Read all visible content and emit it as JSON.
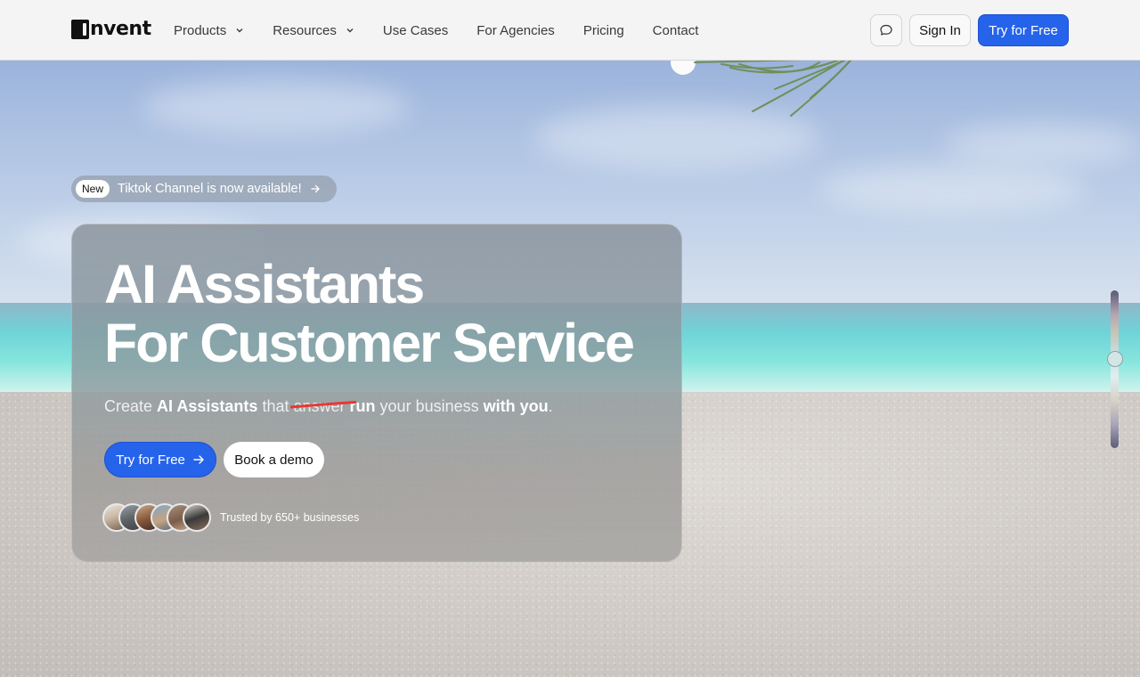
{
  "nav": {
    "logo_text": "nvent",
    "items": [
      {
        "label": "Products",
        "has_dropdown": true
      },
      {
        "label": "Resources",
        "has_dropdown": true
      },
      {
        "label": "Use Cases",
        "has_dropdown": false
      },
      {
        "label": "For Agencies",
        "has_dropdown": false
      },
      {
        "label": "Pricing",
        "has_dropdown": false
      },
      {
        "label": "Contact",
        "has_dropdown": false
      }
    ],
    "chat_icon": "chat-bubble-icon",
    "sign_in_label": "Sign In",
    "try_label": "Try for Free"
  },
  "announcement": {
    "badge": "New",
    "text": "Tiktok Channel is now available!",
    "icon": "arrow-right-icon"
  },
  "hero": {
    "title_line1": "AI Assistants",
    "title_line2": "For Customer Service",
    "subtitle": {
      "w1": "Create",
      "w2": "AI Assistants",
      "w3": "that",
      "struck": "answer",
      "w4": "run",
      "w5": "your business",
      "w6": "with you",
      "w7": "."
    },
    "cta_primary": "Try for Free",
    "cta_secondary": "Book a demo",
    "trusted_text": "Trusted by 650+ businesses"
  },
  "colors": {
    "accent": "#2563eb",
    "strike": "#e53935"
  },
  "slider": {
    "level": 0.4
  }
}
